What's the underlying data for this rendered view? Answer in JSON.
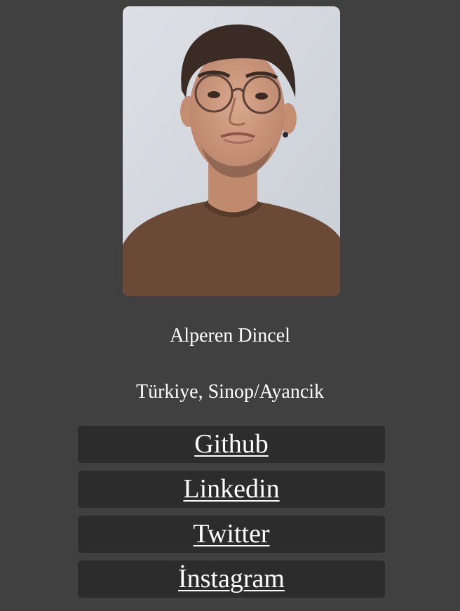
{
  "profile": {
    "name": "Alperen Dincel",
    "location": "Türkiye, Sinop/Ayancik"
  },
  "links": [
    {
      "label": "Github",
      "icon": "none"
    },
    {
      "label": "Linkedin",
      "icon": "none"
    },
    {
      "label": "Twitter",
      "icon": "none"
    },
    {
      "label": "İnstagram",
      "icon": "none"
    }
  ],
  "colors": {
    "page_background": "#404040",
    "button_background": "#2c2c2c",
    "text": "#ffffff"
  }
}
